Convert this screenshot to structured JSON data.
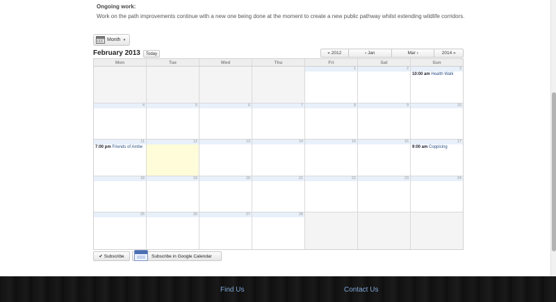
{
  "intro": {
    "title": "Ongoing work:",
    "text": "Work on the path improvements continue with a new one being done at the moment to create a new public pathway whilst extending wildlife corridors."
  },
  "toolbar": {
    "view_label": "Month",
    "month_title": "February 2013",
    "today_label": "Today",
    "nav": [
      "« 2012",
      "‹ Jan",
      "Mar ›",
      "2014 »"
    ]
  },
  "calendar": {
    "weekdays": [
      "Mon",
      "Tue",
      "Wed",
      "Thu",
      "Fri",
      "Sat",
      "Sun"
    ],
    "weeks": [
      [
        {
          "day": "",
          "empty": true
        },
        {
          "day": "",
          "empty": true
        },
        {
          "day": "",
          "empty": true
        },
        {
          "day": "",
          "empty": true
        },
        {
          "day": "1"
        },
        {
          "day": "2"
        },
        {
          "day": "3",
          "events": [
            {
              "time": "10:00 am",
              "title": "Health Walk"
            }
          ]
        }
      ],
      [
        {
          "day": "4"
        },
        {
          "day": "5"
        },
        {
          "day": "6"
        },
        {
          "day": "7"
        },
        {
          "day": "8"
        },
        {
          "day": "9"
        },
        {
          "day": "10"
        }
      ],
      [
        {
          "day": "11",
          "events": [
            {
              "time": "7:00 pm",
              "title": "Friends of Ambe"
            }
          ]
        },
        {
          "day": "12",
          "today": true
        },
        {
          "day": "13"
        },
        {
          "day": "14"
        },
        {
          "day": "15"
        },
        {
          "day": "16"
        },
        {
          "day": "17",
          "events": [
            {
              "time": "9:00 am",
              "title": "Coppicing"
            }
          ]
        }
      ],
      [
        {
          "day": "18"
        },
        {
          "day": "19"
        },
        {
          "day": "20"
        },
        {
          "day": "21"
        },
        {
          "day": "22"
        },
        {
          "day": "23"
        },
        {
          "day": "24"
        }
      ],
      [
        {
          "day": "25"
        },
        {
          "day": "26"
        },
        {
          "day": "27"
        },
        {
          "day": "28"
        },
        {
          "day": "",
          "empty": true
        },
        {
          "day": "",
          "empty": true
        },
        {
          "day": "",
          "empty": true
        }
      ]
    ]
  },
  "subscribe": {
    "subscribe_label": "Subscribe",
    "google_label": "Subscribe in Google Calendar"
  },
  "footer": {
    "links": [
      "Find Us",
      "Contact Us"
    ]
  },
  "colors": {
    "today_highlight": "#fefcd9",
    "day_bar": "#e8f0fa",
    "event_text": "#2b4f86",
    "footer_link": "#7fa8d8"
  },
  "icons": {
    "view_icon": "calendar-icon",
    "check_icon": "check-icon",
    "google_icon": "google-calendar-icon"
  }
}
